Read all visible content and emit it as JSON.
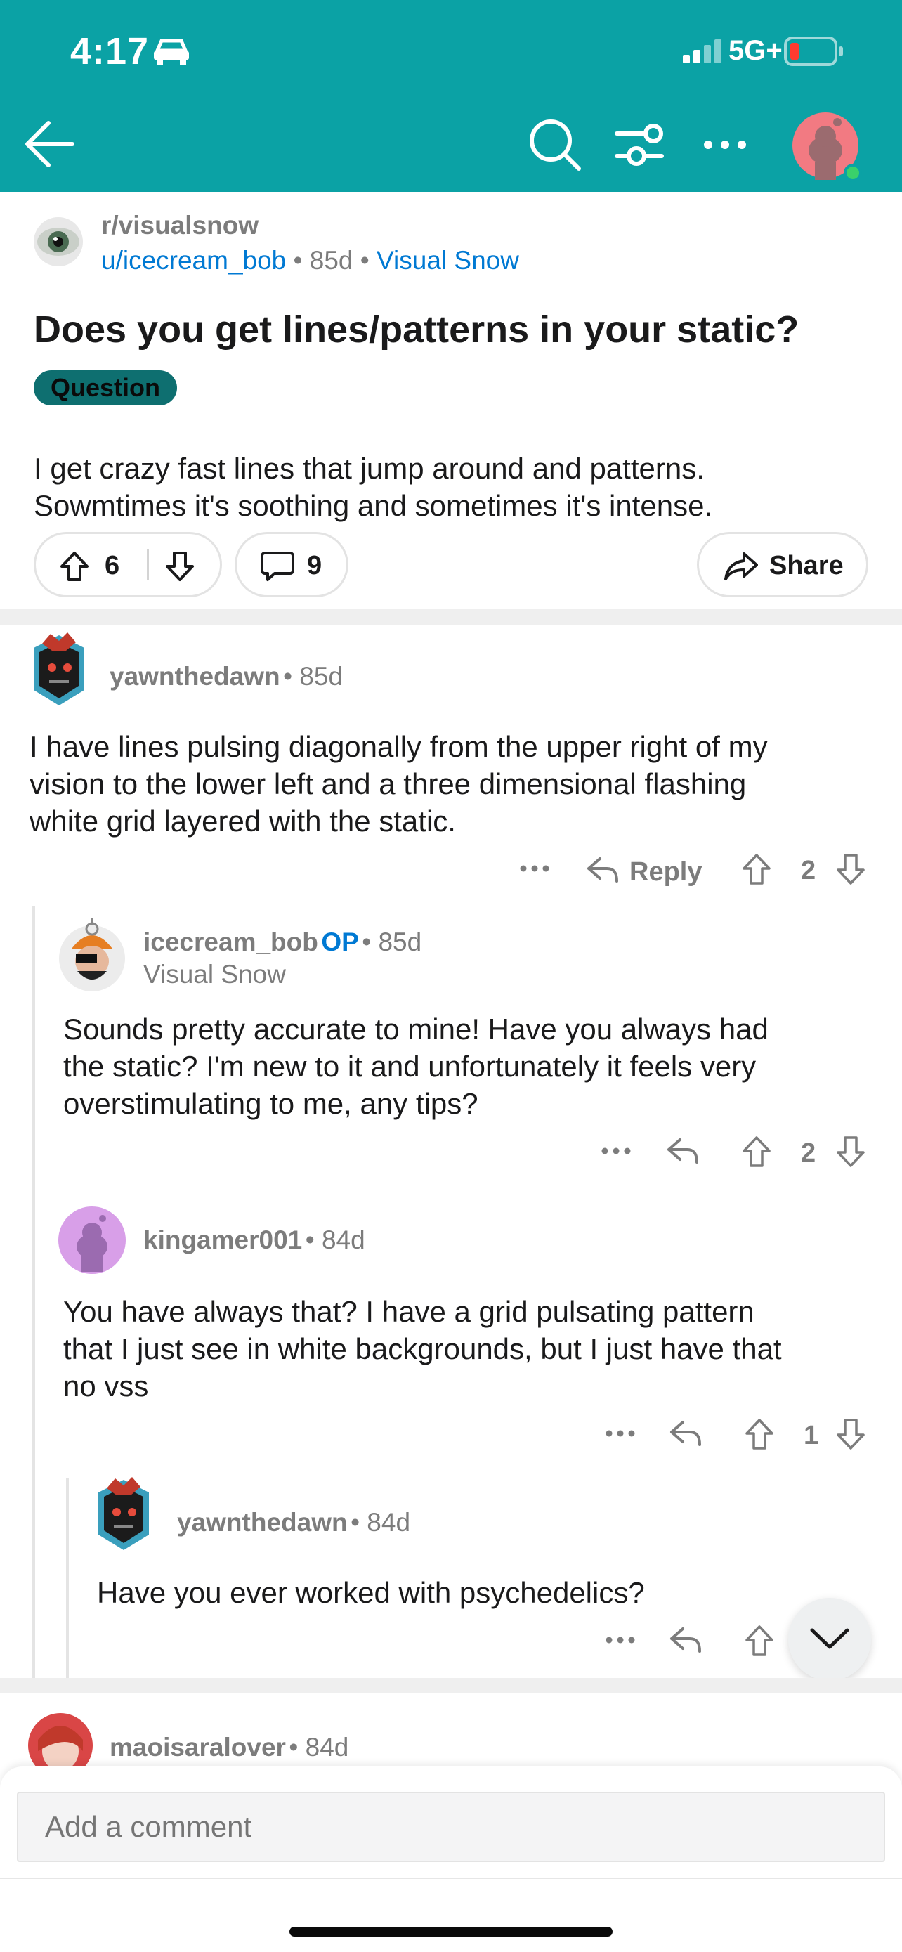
{
  "status_bar": {
    "time": "4:17",
    "network": "5G+"
  },
  "post": {
    "subreddit": "r/visualsnow",
    "author": "u/icecream_bob",
    "age": "85d",
    "flair_link": "Visual Snow",
    "title": "Does you get lines/patterns in your static?",
    "flair": "Question",
    "body_lines": [
      "I get crazy fast lines that jump around and patterns.",
      "Sowmtimes it's soothing and sometimes it's intense."
    ],
    "upvotes": "6",
    "comments": "9",
    "share_label": "Share"
  },
  "comments": [
    {
      "author": "yawnthedawn",
      "age": "85d",
      "body_lines": [
        "I have lines pulsing diagonally from the upper right of my",
        "vision to the lower left and a three dimensional flashing",
        "white grid layered with the static."
      ],
      "reply_label": "Reply",
      "score": "2"
    },
    {
      "author": "icecream_bob",
      "op_badge": "OP",
      "age": "85d",
      "flair": "Visual Snow",
      "body_lines": [
        "Sounds pretty accurate to mine! Have you always had",
        "the static? I'm new to it and unfortunately it feels very",
        "overstimulating to me, any tips?"
      ],
      "score": "2"
    },
    {
      "author": "kingamer001",
      "age": "84d",
      "body_lines": [
        "You have always that? I have a grid pulsating pattern",
        "that I just see in white backgrounds, but I just have that",
        "no vss"
      ],
      "score": "1"
    },
    {
      "author": "yawnthedawn",
      "age": "84d",
      "body_lines": [
        "Have you ever worked with psychedelics?"
      ]
    },
    {
      "author": "maoisaralover",
      "age": "84d"
    }
  ],
  "composer": {
    "placeholder": "Add a comment"
  },
  "colors": {
    "header": "#0ba2a5",
    "flair": "#0e6f70",
    "link": "#0079d3"
  }
}
